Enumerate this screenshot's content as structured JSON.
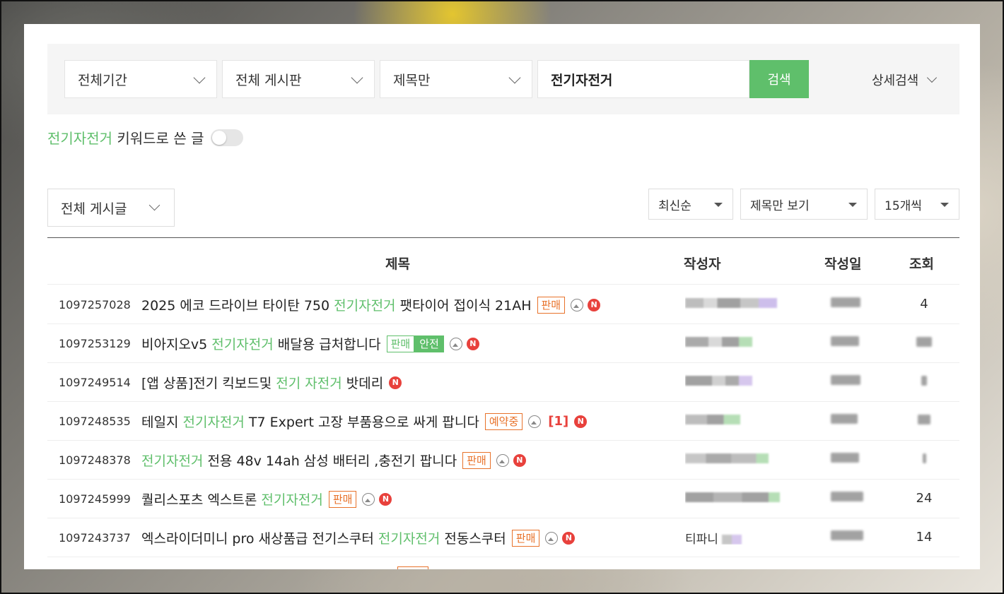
{
  "search": {
    "period": "전체기간",
    "board": "전체 게시판",
    "scope": "제목만",
    "query": "전기자전거",
    "button": "검색",
    "advanced": "상세검색"
  },
  "keyword_line": {
    "keyword": "전기자전거",
    "suffix": " 키워드로 쓴 글"
  },
  "filters": {
    "post_type": "전체 게시글",
    "sort": "최신순",
    "view": "제목만 보기",
    "per_page": "15개씩"
  },
  "table": {
    "headers": {
      "title": "제목",
      "author": "작성자",
      "date": "작성일",
      "views": "조회"
    },
    "rows": [
      {
        "id": "1097257028",
        "title_pre": "2025 에코 드라이브 타이탄 750 ",
        "title_hl": "전기자전거",
        "title_post": " 팻타이어 접이식 21AH",
        "badge": "판매",
        "views": "4"
      },
      {
        "id": "1097253129",
        "title_pre": "비아지오v5 ",
        "title_hl": "전기자전거",
        "title_post": " 배달용 급처합니다",
        "badge": "판매",
        "badge2": "안전",
        "views": ""
      },
      {
        "id": "1097249514",
        "title_pre": "[앱 상품]전기 킥보드및 ",
        "title_hl": "전기 자전거",
        "title_post": " 밧데리",
        "views": ""
      },
      {
        "id": "1097248535",
        "title_pre": "테일지 ",
        "title_hl": "전기자전거",
        "title_post": " T7 Expert 고장 부품용으로 싸게 팝니다",
        "badge": "예약중",
        "comments": "[1]",
        "views": ""
      },
      {
        "id": "1097248378",
        "title_pre": "",
        "title_hl": "전기자전거",
        "title_post": " 전용 48v 14ah 삼성 배터리 ,충전기 팝니다",
        "badge": "판매",
        "views": ""
      },
      {
        "id": "1097245999",
        "title_pre": "퀄리스포츠 엑스트론 ",
        "title_hl": "전기자전거",
        "title_post": "",
        "badge": "판매",
        "views": "24"
      },
      {
        "id": "1097243737",
        "title_pre": "엑스라이더미니 pro 새상품급 전기스쿠터 ",
        "title_hl": "전기자전거",
        "title_post": " 전동스쿠터",
        "badge": "판매",
        "author": "티파니",
        "views": "14"
      }
    ]
  },
  "colors": {
    "accent_green": "#5fbf6b",
    "badge_orange": "#e8722a",
    "new_red": "#e8413c"
  }
}
